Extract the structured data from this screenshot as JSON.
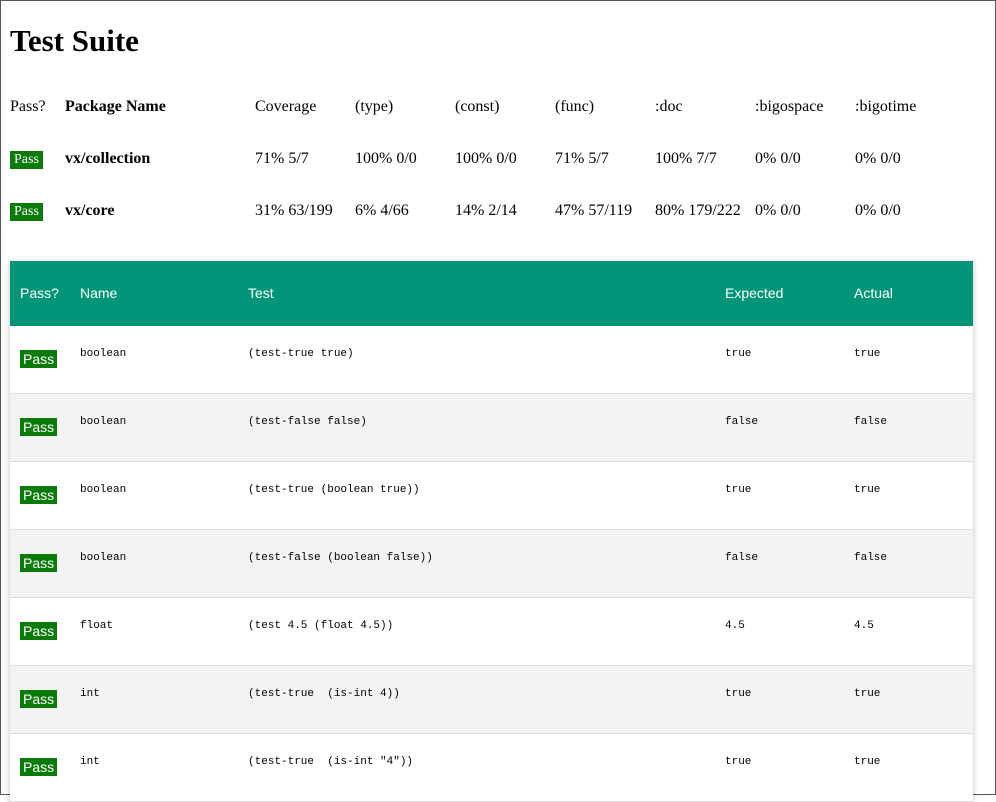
{
  "page": {
    "title": "Test Suite"
  },
  "summary": {
    "headers": [
      "Pass?",
      "Package Name",
      "Coverage",
      "(type)",
      "(const)",
      "(func)",
      ":doc",
      ":bigospace",
      ":bigotime"
    ],
    "rows": [
      {
        "pass": "Pass",
        "package": "vx/collection",
        "coverage": "71% 5/7",
        "type": "100% 0/0",
        "const": "100% 0/0",
        "func": "71% 5/7",
        "doc": "100% 7/7",
        "bigospace": "0% 0/0",
        "bigotime": "0% 0/0"
      },
      {
        "pass": "Pass",
        "package": "vx/core",
        "coverage": "31% 63/199",
        "type": "6% 4/66",
        "const": "14% 2/14",
        "func": "47% 57/119",
        "doc": "80% 179/222",
        "bigospace": "0% 0/0",
        "bigotime": "0% 0/0"
      }
    ]
  },
  "results": {
    "headers": {
      "pass": "Pass?",
      "name": "Name",
      "test": "Test",
      "expected": "Expected",
      "actual": "Actual"
    },
    "rows": [
      {
        "pass": "Pass",
        "name": "boolean",
        "test": "(test-true true)",
        "expected": "true",
        "actual": "true"
      },
      {
        "pass": "Pass",
        "name": "boolean",
        "test": "(test-false false)",
        "expected": "false",
        "actual": "false"
      },
      {
        "pass": "Pass",
        "name": "boolean",
        "test": "(test-true (boolean true))",
        "expected": "true",
        "actual": "true"
      },
      {
        "pass": "Pass",
        "name": "boolean",
        "test": "(test-false (boolean false))",
        "expected": "false",
        "actual": "false"
      },
      {
        "pass": "Pass",
        "name": "float",
        "test": "(test 4.5 (float 4.5))",
        "expected": "4.5",
        "actual": "4.5"
      },
      {
        "pass": "Pass",
        "name": "int",
        "test": "(test-true  (is-int 4))",
        "expected": "true",
        "actual": "true"
      },
      {
        "pass": "Pass",
        "name": "int",
        "test": "(test-true  (is-int \"4\"))",
        "expected": "true",
        "actual": "true"
      }
    ]
  },
  "colors": {
    "header_bg": "#009578",
    "badge_bg": "#0a7a0a",
    "alt_row": "#f3f3f3"
  }
}
